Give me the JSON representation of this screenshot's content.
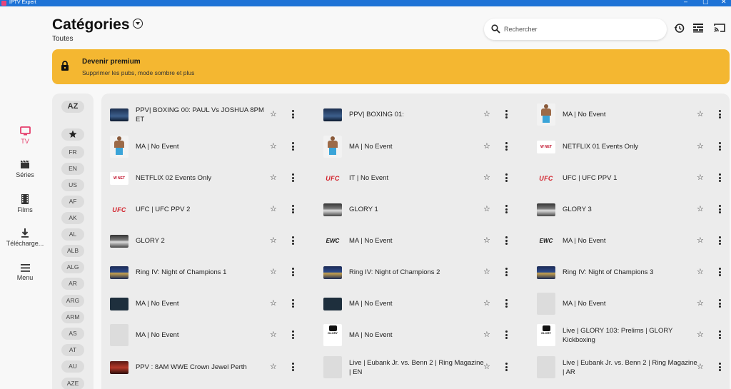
{
  "window": {
    "app_name": "IPTV Expert"
  },
  "nav": {
    "items": [
      {
        "id": "tv",
        "label": "TV",
        "icon": "tv-icon",
        "active": true
      },
      {
        "id": "series",
        "label": "Séries",
        "icon": "clapperboard-icon",
        "active": false
      },
      {
        "id": "films",
        "label": "Films",
        "icon": "film-icon",
        "active": false
      },
      {
        "id": "downloads",
        "label": "Télécharge...",
        "icon": "download-icon",
        "active": false
      },
      {
        "id": "menu",
        "label": "Menu",
        "icon": "hamburger-icon",
        "active": false
      }
    ]
  },
  "header": {
    "title": "Catégories",
    "subtitle": "Toutes",
    "search_placeholder": "Rechercher"
  },
  "banner": {
    "title": "Devenir premium",
    "subtitle": "Supprimer les pubs, mode sombre et plus",
    "color": "#f4b731"
  },
  "filters": {
    "sort_label": "AZ",
    "codes": [
      "FR",
      "EN",
      "US",
      "AF",
      "AK",
      "AL",
      "ALB",
      "ALG",
      "AR",
      "ARG",
      "ARM",
      "AS",
      "AT",
      "AU",
      "AZE"
    ]
  },
  "categories": [
    [
      "PPV| BOXING 00: PAUL Vs JOSHUA 8PM ET",
      "PPV| BOXING 01:",
      "MA | No Event"
    ],
    [
      "MA | No Event",
      "MA | No Event",
      "NETFLIX 01 Events Only"
    ],
    [
      "NETFLIX 02 Events Only",
      "IT | No Event",
      "UFC | UFC PPV 1"
    ],
    [
      "UFC | UFC PPV 2",
      "GLORY 1",
      "GLORY 3"
    ],
    [
      "GLORY 2",
      "MA | No Event",
      "MA | No Event"
    ],
    [
      "Ring IV: Night of Champions 1",
      "Ring IV: Night of Champions 2",
      "Ring IV: Night of Champions 3"
    ],
    [
      "MA | No Event",
      "MA | No Event",
      "MA | No Event"
    ],
    [
      "MA | No Event",
      "MA | No Event",
      "Live | GLORY 103: Prelims | GLORY Kickboxing"
    ],
    [
      "PPV : 8AM WWE Crown Jewel Perth",
      "Live | Eubank Jr. vs. Benn 2 | Ring Magazine | EN",
      "Live | Eubank Jr. vs. Benn 2 | Ring Magazine | AR"
    ]
  ],
  "thumbs": [
    [
      "boxing-thumb",
      "boxing-thumb",
      "fighter-thumb"
    ],
    [
      "fighter-thumb",
      "fighter-thumb",
      "wwe-logo"
    ],
    [
      "wwe-logo",
      "ufc-logo",
      "ufc-logo"
    ],
    [
      "ufc-logo",
      "glory-thumb",
      "glory-thumb"
    ],
    [
      "glory-thumb",
      "elite-logo",
      "elite-logo"
    ],
    [
      "ring-thumb",
      "ring-thumb",
      "ring-thumb"
    ],
    [
      "dark-thumb",
      "dark-thumb",
      "blank-thumb"
    ],
    [
      "blank-thumb",
      "glory-logo",
      "glory-logo"
    ],
    [
      "red-thumb",
      "blank-thumb",
      "blank-thumb"
    ]
  ],
  "colors": {
    "accent": "#e53e6c",
    "banner": "#f4b731",
    "titlebar": "#1e73d6"
  }
}
